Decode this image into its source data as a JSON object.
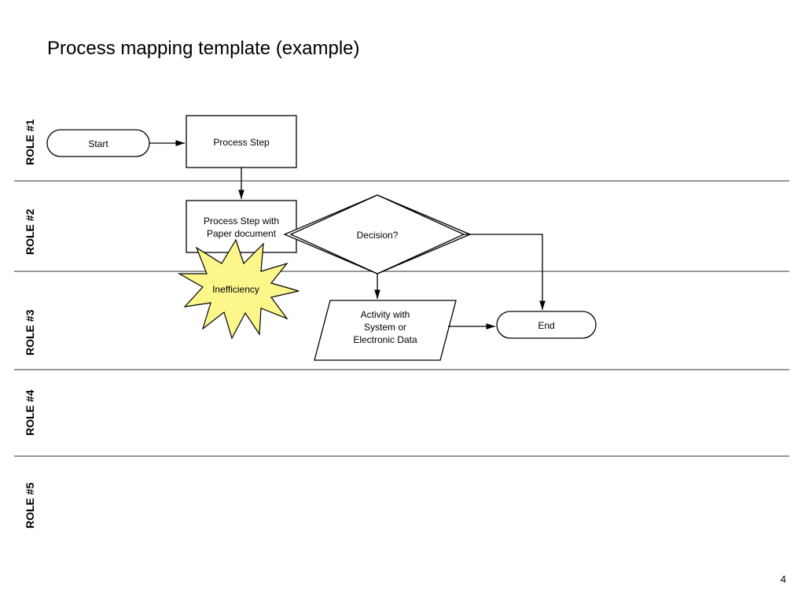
{
  "title": "Process mapping template (example)",
  "page_number": "4",
  "roles": {
    "r1": "ROLE #1",
    "r2": "ROLE #2",
    "r3": "ROLE #3",
    "r4": "ROLE #4",
    "r5": "ROLE #5"
  },
  "nodes": {
    "start": "Start",
    "step1": "Process Step",
    "step2a": "Process Step with",
    "step2b": "Paper document",
    "ineff": "Inefficiency",
    "decision": "Decision?",
    "activity1": "Activity with",
    "activity2": "System or",
    "activity3": "Electronic Data",
    "end": "End"
  }
}
